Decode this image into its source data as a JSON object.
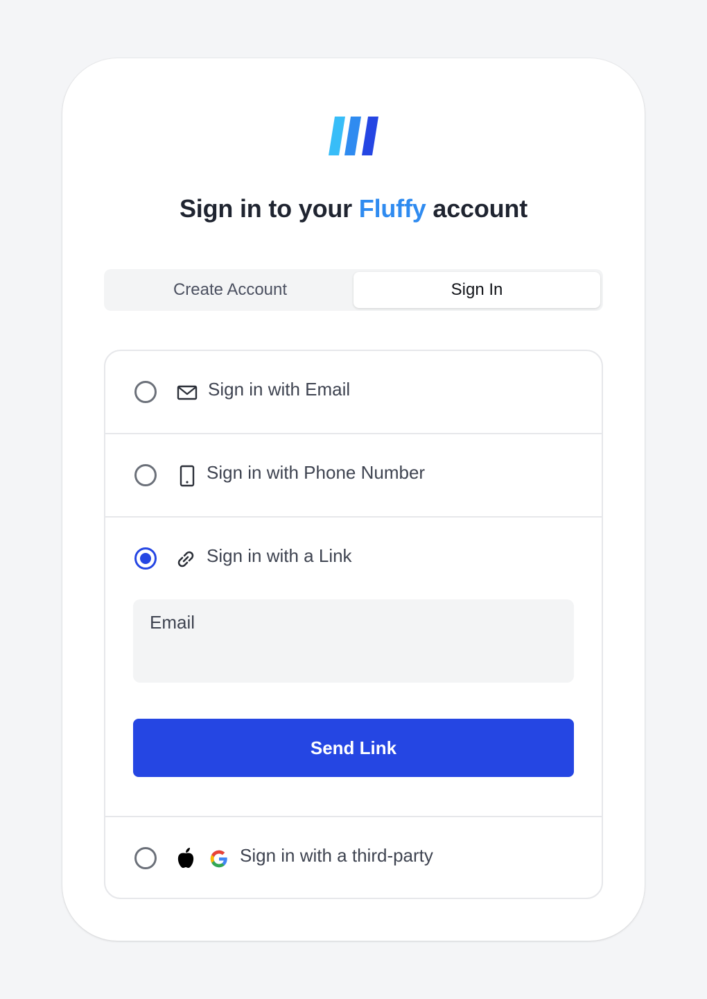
{
  "colors": {
    "background": "#f4f5f7",
    "brand": "#2f8bf0",
    "accent": "#2546e3",
    "logo": [
      "#38bdf8",
      "#2f8bf0",
      "#2546e3"
    ]
  },
  "header": {
    "logo_icon": "striped-logo-icon",
    "title_before": "Sign in to your",
    "title_brand": "Fluffy",
    "title_after": "account"
  },
  "tabs": [
    {
      "label": "Create Account",
      "selected": false
    },
    {
      "label": "Sign In",
      "selected": true
    }
  ],
  "options": [
    {
      "label": "Sign in with Email",
      "icon": "envelope-icon",
      "selected": false
    },
    {
      "label": "Sign in with Phone Number",
      "icon": "phone-icon",
      "selected": false
    },
    {
      "label": "Sign in with a Link",
      "icon": "link-icon",
      "selected": true
    },
    {
      "label": "Sign in with a third-party",
      "icons": [
        "apple-icon",
        "google-icon"
      ],
      "selected": false
    }
  ],
  "link_form": {
    "email_label": "Email",
    "email_value": "",
    "submit_label": "Send Link"
  }
}
